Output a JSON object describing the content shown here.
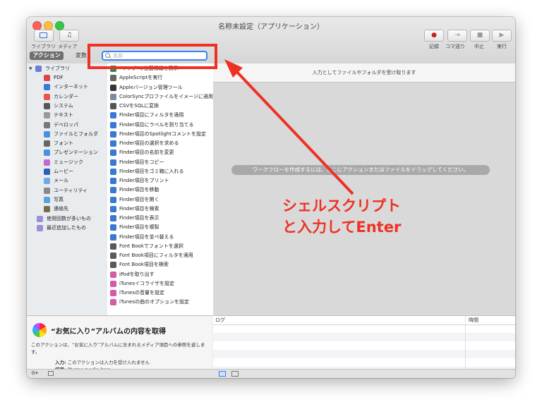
{
  "window": {
    "title": "名称未設定（アプリケーション）",
    "toolbar_left": [
      {
        "label": "ライブラリ"
      },
      {
        "label": "メディア"
      }
    ],
    "toolbar_right": [
      {
        "label": "記録"
      },
      {
        "label": "コマ送り"
      },
      {
        "label": "中止"
      },
      {
        "label": "実行"
      }
    ]
  },
  "segments": {
    "actions": "アクション",
    "variables": "変数"
  },
  "search": {
    "placeholder": "名前"
  },
  "library": {
    "root": "ライブラリ",
    "items": [
      "PDF",
      "インターネット",
      "カレンダー",
      "システム",
      "テキスト",
      "デベロッパ",
      "ファイルとフォルダ",
      "フォント",
      "プレゼンテーション",
      "ミュージック",
      "ムービー",
      "メール",
      "ユーティリティ",
      "写真",
      "連絡先"
    ],
    "extras": [
      "使用回数が多いもの",
      "最近追加したもの"
    ],
    "icon_colors": [
      "#d44",
      "#3a7bd5",
      "#e8544a",
      "#555",
      "#999",
      "#777",
      "#4a8fe0",
      "#666",
      "#4a90e2",
      "#c06bd4",
      "#2b5fb8",
      "#6ea8e8",
      "#888",
      "#58a0e0",
      "#7a6a4a"
    ]
  },
  "actions": {
    "items": [
      "\"マップ\"で位置情報を表示",
      "AppleScriptを実行",
      "Appleバージョン管理ツール",
      "ColorSyncプロファイルをイメージに適用",
      "CSVをSQLに変換",
      "Finder項目にフィルタを適用",
      "Finder項目にラベルを割り当てる",
      "Finder項目のSpotlightコメントを設定",
      "Finder項目の選択を求める",
      "Finder項目の名前を変更",
      "Finder項目をコピー",
      "Finder項目をゴミ箱に入れる",
      "Finder項目をプリント",
      "Finder項目を移動",
      "Finder項目を開く",
      "Finder項目を検索",
      "Finder項目を表示",
      "Finder項目を複製",
      "Finder項目を並べ替える",
      "Font Bookでフォントを選択",
      "Font Book項目にフィルタを適用",
      "Font Book項目を検索",
      "iPodを取り出す",
      "iTunesイコライザを設定",
      "iTunesの音量を設定",
      "iTunesの曲のオプションを設定"
    ]
  },
  "info": {
    "title": "“お気に入り”アルバムの内容を取得",
    "description": "このアクションは、“お気に入り”アルバムに含まれるメディア項目への参照を返します。",
    "input_label": "入力:",
    "input_value": "このアクションは入力を受け入れません",
    "output_label": "結果:",
    "output_value": "Photos media item"
  },
  "workflow": {
    "header": "入力としてファイルやフォルダを受け取ります",
    "hint": "ワークフローを作成するには、ここにアクションまたはファイルをドラッグしてください。"
  },
  "log": {
    "col_log": "ログ",
    "col_time": "時間"
  },
  "annotation": {
    "line1": "シェルスクリプト",
    "line2": "と入力してEnter"
  }
}
